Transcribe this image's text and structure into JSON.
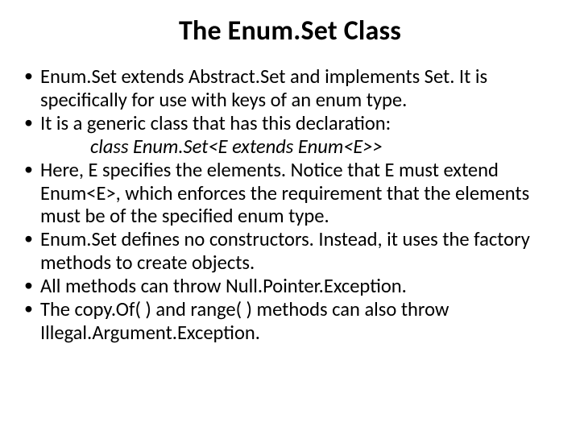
{
  "title": "The Enum.Set Class",
  "bullets": [
    {
      "text": "Enum.Set extends Abstract.Set and implements Set. It is specifically for use with keys of an enum type."
    },
    {
      "text": "It is a generic class that has this declaration:",
      "code": "class Enum.Set<E extends Enum<E>>"
    },
    {
      "text": "Here, E specifies the elements. Notice that E must extend Enum<E>, which enforces the requirement that the elements must be of the specified enum type."
    },
    {
      "text": "Enum.Set defines no constructors. Instead, it uses the factory methods to create objects."
    },
    {
      "text": "All methods can throw Null.Pointer.Exception."
    },
    {
      "text": "The copy.Of( ) and range( ) methods can also throw Illegal.Argument.Exception."
    }
  ]
}
